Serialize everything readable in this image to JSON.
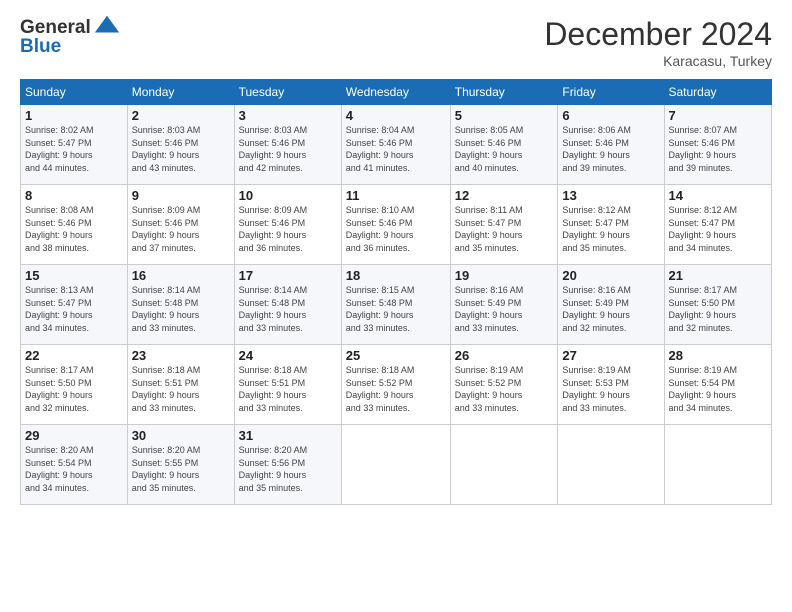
{
  "header": {
    "logo_line1": "General",
    "logo_line2": "Blue",
    "title": "December 2024",
    "subtitle": "Karacasu, Turkey"
  },
  "calendar": {
    "days_of_week": [
      "Sunday",
      "Monday",
      "Tuesday",
      "Wednesday",
      "Thursday",
      "Friday",
      "Saturday"
    ],
    "weeks": [
      [
        {
          "num": "",
          "info": ""
        },
        {
          "num": "1",
          "info": "Sunrise: 8:02 AM\nSunset: 5:47 PM\nDaylight: 9 hours\nand 44 minutes."
        },
        {
          "num": "2",
          "info": "Sunrise: 8:03 AM\nSunset: 5:46 PM\nDaylight: 9 hours\nand 43 minutes."
        },
        {
          "num": "3",
          "info": "Sunrise: 8:03 AM\nSunset: 5:46 PM\nDaylight: 9 hours\nand 42 minutes."
        },
        {
          "num": "4",
          "info": "Sunrise: 8:04 AM\nSunset: 5:46 PM\nDaylight: 9 hours\nand 41 minutes."
        },
        {
          "num": "5",
          "info": "Sunrise: 8:05 AM\nSunset: 5:46 PM\nDaylight: 9 hours\nand 40 minutes."
        },
        {
          "num": "6",
          "info": "Sunrise: 8:06 AM\nSunset: 5:46 PM\nDaylight: 9 hours\nand 39 minutes."
        },
        {
          "num": "7",
          "info": "Sunrise: 8:07 AM\nSunset: 5:46 PM\nDaylight: 9 hours\nand 39 minutes."
        }
      ],
      [
        {
          "num": "8",
          "info": "Sunrise: 8:08 AM\nSunset: 5:46 PM\nDaylight: 9 hours\nand 38 minutes."
        },
        {
          "num": "9",
          "info": "Sunrise: 8:09 AM\nSunset: 5:46 PM\nDaylight: 9 hours\nand 37 minutes."
        },
        {
          "num": "10",
          "info": "Sunrise: 8:09 AM\nSunset: 5:46 PM\nDaylight: 9 hours\nand 36 minutes."
        },
        {
          "num": "11",
          "info": "Sunrise: 8:10 AM\nSunset: 5:46 PM\nDaylight: 9 hours\nand 36 minutes."
        },
        {
          "num": "12",
          "info": "Sunrise: 8:11 AM\nSunset: 5:47 PM\nDaylight: 9 hours\nand 35 minutes."
        },
        {
          "num": "13",
          "info": "Sunrise: 8:12 AM\nSunset: 5:47 PM\nDaylight: 9 hours\nand 35 minutes."
        },
        {
          "num": "14",
          "info": "Sunrise: 8:12 AM\nSunset: 5:47 PM\nDaylight: 9 hours\nand 34 minutes."
        }
      ],
      [
        {
          "num": "15",
          "info": "Sunrise: 8:13 AM\nSunset: 5:47 PM\nDaylight: 9 hours\nand 34 minutes."
        },
        {
          "num": "16",
          "info": "Sunrise: 8:14 AM\nSunset: 5:48 PM\nDaylight: 9 hours\nand 33 minutes."
        },
        {
          "num": "17",
          "info": "Sunrise: 8:14 AM\nSunset: 5:48 PM\nDaylight: 9 hours\nand 33 minutes."
        },
        {
          "num": "18",
          "info": "Sunrise: 8:15 AM\nSunset: 5:48 PM\nDaylight: 9 hours\nand 33 minutes."
        },
        {
          "num": "19",
          "info": "Sunrise: 8:16 AM\nSunset: 5:49 PM\nDaylight: 9 hours\nand 33 minutes."
        },
        {
          "num": "20",
          "info": "Sunrise: 8:16 AM\nSunset: 5:49 PM\nDaylight: 9 hours\nand 32 minutes."
        },
        {
          "num": "21",
          "info": "Sunrise: 8:17 AM\nSunset: 5:50 PM\nDaylight: 9 hours\nand 32 minutes."
        }
      ],
      [
        {
          "num": "22",
          "info": "Sunrise: 8:17 AM\nSunset: 5:50 PM\nDaylight: 9 hours\nand 32 minutes."
        },
        {
          "num": "23",
          "info": "Sunrise: 8:18 AM\nSunset: 5:51 PM\nDaylight: 9 hours\nand 33 minutes."
        },
        {
          "num": "24",
          "info": "Sunrise: 8:18 AM\nSunset: 5:51 PM\nDaylight: 9 hours\nand 33 minutes."
        },
        {
          "num": "25",
          "info": "Sunrise: 8:18 AM\nSunset: 5:52 PM\nDaylight: 9 hours\nand 33 minutes."
        },
        {
          "num": "26",
          "info": "Sunrise: 8:19 AM\nSunset: 5:52 PM\nDaylight: 9 hours\nand 33 minutes."
        },
        {
          "num": "27",
          "info": "Sunrise: 8:19 AM\nSunset: 5:53 PM\nDaylight: 9 hours\nand 33 minutes."
        },
        {
          "num": "28",
          "info": "Sunrise: 8:19 AM\nSunset: 5:54 PM\nDaylight: 9 hours\nand 34 minutes."
        }
      ],
      [
        {
          "num": "29",
          "info": "Sunrise: 8:20 AM\nSunset: 5:54 PM\nDaylight: 9 hours\nand 34 minutes."
        },
        {
          "num": "30",
          "info": "Sunrise: 8:20 AM\nSunset: 5:55 PM\nDaylight: 9 hours\nand 35 minutes."
        },
        {
          "num": "31",
          "info": "Sunrise: 8:20 AM\nSunset: 5:56 PM\nDaylight: 9 hours\nand 35 minutes."
        },
        {
          "num": "",
          "info": ""
        },
        {
          "num": "",
          "info": ""
        },
        {
          "num": "",
          "info": ""
        },
        {
          "num": "",
          "info": ""
        }
      ]
    ]
  }
}
